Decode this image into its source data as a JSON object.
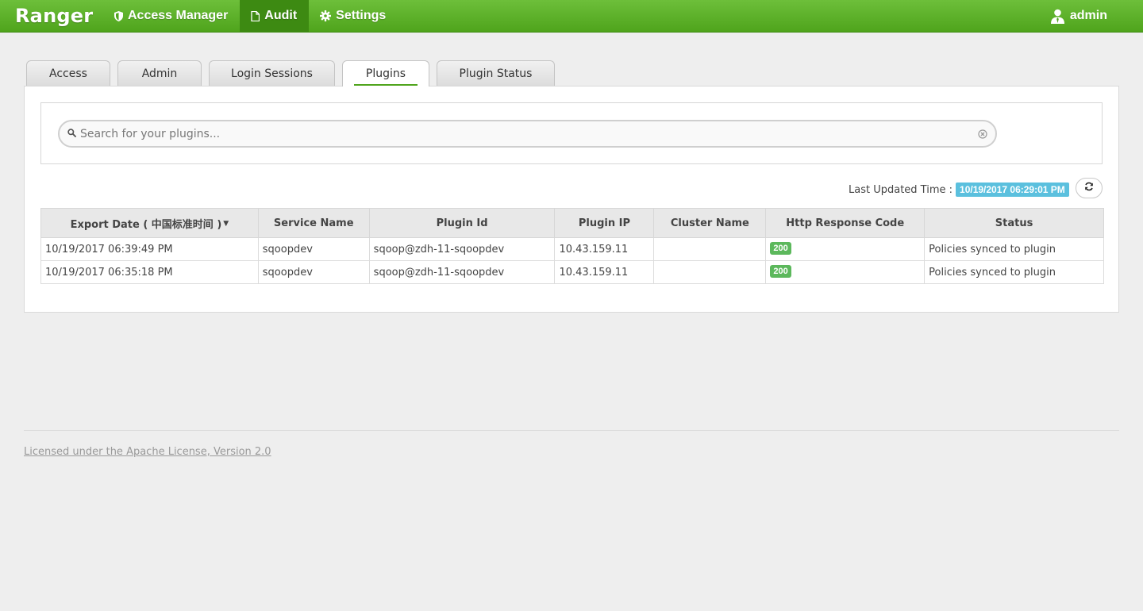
{
  "navbar": {
    "brand": "Ranger",
    "items": [
      {
        "label": "Access Manager",
        "icon": "shield-icon"
      },
      {
        "label": "Audit",
        "icon": "file-icon"
      },
      {
        "label": "Settings",
        "icon": "gear-icon"
      }
    ],
    "active_item": "Audit",
    "user": "admin",
    "colors": {
      "bar": "#5cb02a",
      "active": "#3d8a12"
    }
  },
  "tabs": [
    {
      "label": "Access"
    },
    {
      "label": "Admin"
    },
    {
      "label": "Login Sessions"
    },
    {
      "label": "Plugins"
    },
    {
      "label": "Plugin Status"
    }
  ],
  "active_tab": "Plugins",
  "search": {
    "placeholder": "Search for your plugins..."
  },
  "last_updated": {
    "label": "Last Updated Time :",
    "value": "10/19/2017 06:29:01 PM"
  },
  "table": {
    "columns": [
      "Export Date ( 中国标准时间 )",
      "Service Name",
      "Plugin Id",
      "Plugin IP",
      "Cluster Name",
      "Http Response Code",
      "Status"
    ],
    "rows": [
      {
        "export_date": "10/19/2017 06:39:49 PM",
        "service_name": "sqoopdev",
        "plugin_id": "sqoop@zdh-11-sqoopdev",
        "plugin_ip": "10.43.159.11",
        "cluster_name": "",
        "http_code": "200",
        "status": "Policies synced to plugin"
      },
      {
        "export_date": "10/19/2017 06:35:18 PM",
        "service_name": "sqoopdev",
        "plugin_id": "sqoop@zdh-11-sqoopdev",
        "plugin_ip": "10.43.159.11",
        "cluster_name": "",
        "http_code": "200",
        "status": "Policies synced to plugin"
      }
    ]
  },
  "footer": {
    "license": "Licensed under the Apache License, Version 2.0"
  }
}
